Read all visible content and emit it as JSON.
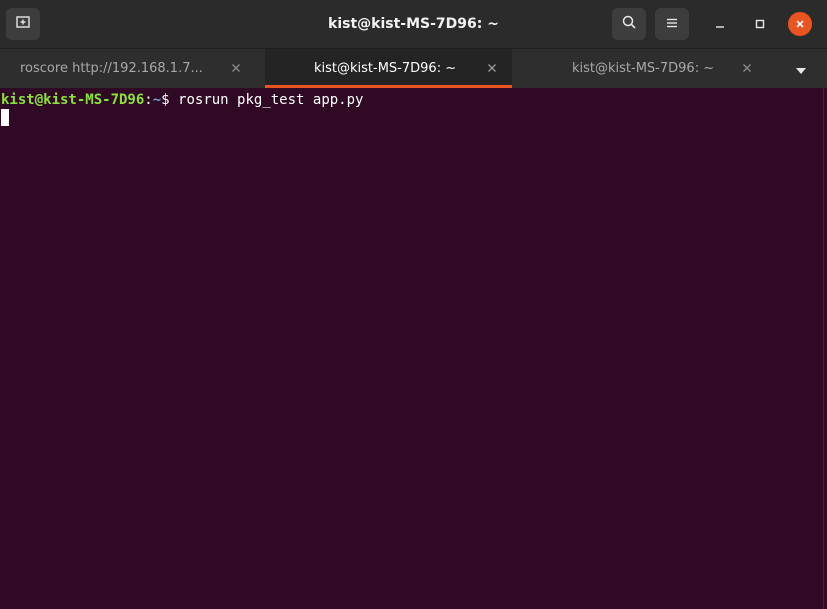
{
  "window": {
    "title": "kist@kist-MS-7D96: ~"
  },
  "titlebar": {
    "new_tab_icon": "new-tab-icon",
    "search_icon": "search-icon",
    "menu_icon": "hamburger-menu-icon",
    "minimize_icon": "minimize-icon",
    "maximize_icon": "maximize-icon",
    "close_icon": "close-icon"
  },
  "tabs": [
    {
      "label": "roscore http://192.168.1.7...",
      "active": false
    },
    {
      "label": "kist@kist-MS-7D96: ~",
      "active": true
    },
    {
      "label": "kist@kist-MS-7D96: ~",
      "active": false
    }
  ],
  "terminal": {
    "prompt_user_host": "kist@kist-MS-7D96",
    "prompt_colon": ":",
    "prompt_path": "~",
    "prompt_symbol": "$ ",
    "command": "rosrun pkg_test app.py"
  },
  "colors": {
    "background": "#300a24",
    "accent": "#e95420",
    "prompt_user": "#8ae234",
    "prompt_path": "#729fcf"
  }
}
